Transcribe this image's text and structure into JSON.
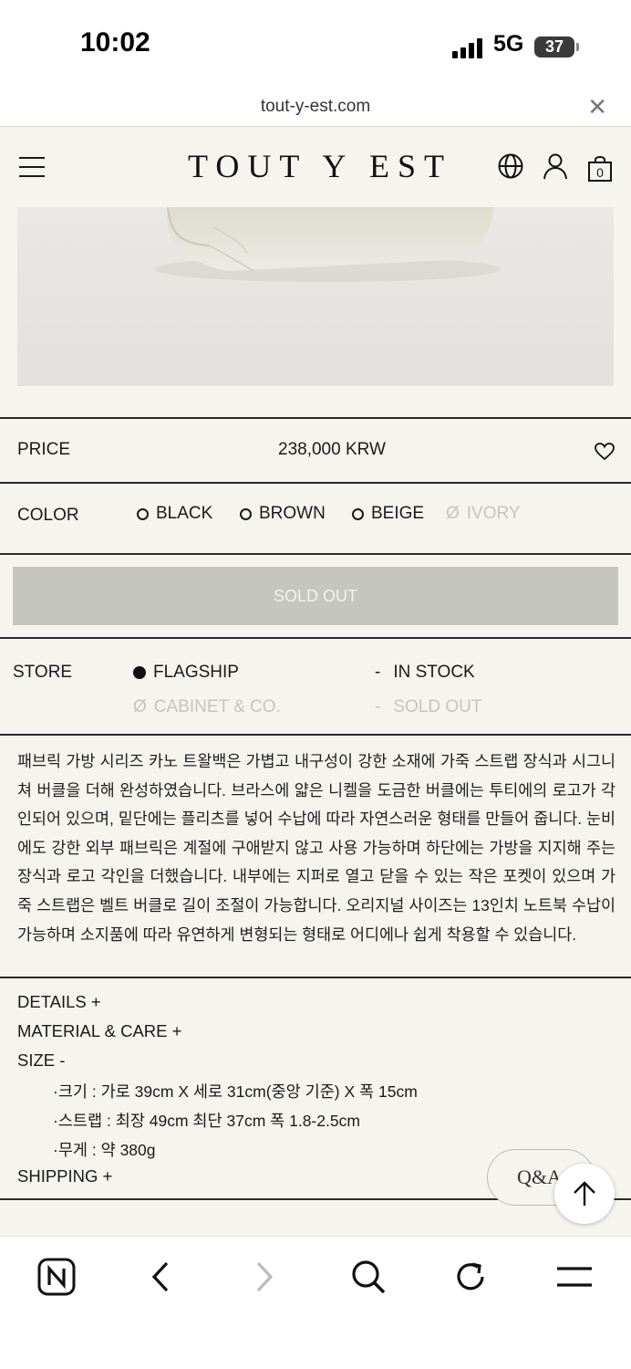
{
  "status": {
    "time": "10:02",
    "network": "5G",
    "battery": "37"
  },
  "browser": {
    "url": "tout-y-est.com"
  },
  "header": {
    "logo": "TOUT Y EST",
    "cart_count": "0"
  },
  "price": {
    "label": "PRICE",
    "value": "238,000 KRW"
  },
  "color": {
    "label": "COLOR",
    "options": [
      {
        "name": "BLACK",
        "available": true
      },
      {
        "name": "BROWN",
        "available": true
      },
      {
        "name": "BEIGE",
        "available": true
      },
      {
        "name": "IVORY",
        "available": false
      }
    ]
  },
  "purchase": {
    "sold_out_label": "SOLD OUT"
  },
  "store": {
    "label": "STORE",
    "stores": [
      {
        "name": "FLAGSHIP",
        "status": "IN STOCK",
        "selected": true
      },
      {
        "name": "CABINET & CO.",
        "status": "SOLD OUT",
        "selected": false
      }
    ],
    "disabled_prefix": "Ø",
    "status_prefix": "-"
  },
  "description": "패브릭 가방 시리즈 카노 트왈백은 가볍고 내구성이 강한 소재에 가죽 스트랩 장식과 시그니쳐 버클을 더해 완성하였습니다. 브라스에 얇은 니켈을 도금한 버클에는 투티에의 로고가 각인되어 있으며, 밑단에는 플리츠를 넣어 수납에 따라 자연스러운 형태를 만들어 줍니다. 눈비에도 강한 외부 패브릭은 계절에 구애받지 않고 사용 가능하며 하단에는 가방을 지지해 주는 장식과 로고 각인을 더했습니다. 내부에는 지퍼로 열고 닫을 수 있는 작은 포켓이 있으며 가죽 스트랩은 벨트 버클로 길이 조절이 가능합니다. 오리지널 사이즈는 13인치 노트북 수납이 가능하며 소지품에 따라 유연하게 변형되는 형태로 어디에나 쉽게 착용할 수 있습니다.",
  "accordion": {
    "details": "DETAILS +",
    "material": "MATERIAL & CARE +",
    "size": "SIZE -",
    "size_items": [
      "·크기 : 가로 39cm X 세로 31cm(중앙 기준) X 폭 15cm",
      "·스트랩 : 최장 49cm 최단 37cm 폭 1.8-2.5cm",
      "·무게 : 약 380g"
    ],
    "shipping": "SHIPPING +"
  },
  "floating": {
    "qa": "Q&A"
  },
  "icons": [
    "menu-icon",
    "globe-icon",
    "user-icon",
    "bag-icon",
    "heart-icon",
    "arrow-up-icon",
    "naver-icon",
    "back-icon",
    "forward-icon",
    "search-icon",
    "refresh-icon",
    "tabs-menu-icon"
  ]
}
